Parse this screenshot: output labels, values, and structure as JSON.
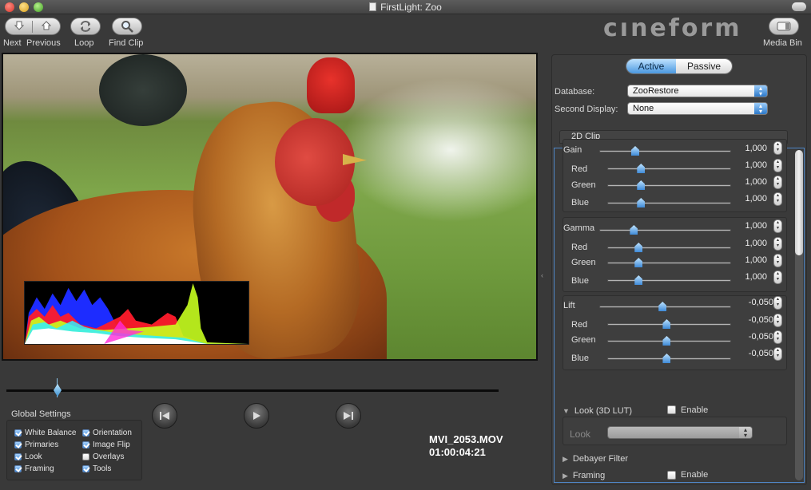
{
  "window": {
    "title": "FirstLight: Zoo"
  },
  "toolbar": {
    "next_label": "Next",
    "previous_label": "Previous",
    "loop_label": "Loop",
    "find_clip_label": "Find Clip",
    "media_bin_label": "Media Bin",
    "brand": "cıneform"
  },
  "viewer": {
    "clip_name": "MVI_2053.MOV",
    "timecode": "01:00:04:21"
  },
  "global_settings": {
    "title": "Global Settings",
    "items": [
      {
        "label": "White Balance",
        "checked": true
      },
      {
        "label": "Primaries",
        "checked": true
      },
      {
        "label": "Look",
        "checked": true
      },
      {
        "label": "Framing",
        "checked": true
      },
      {
        "label": "Orientation",
        "checked": true
      },
      {
        "label": "Image Flip",
        "checked": true
      },
      {
        "label": "Overlays",
        "checked": false
      },
      {
        "label": "Tools",
        "checked": true
      }
    ]
  },
  "panel": {
    "tabs": {
      "active": "Active",
      "passive": "Passive"
    },
    "database_label": "Database:",
    "database_value": "ZooRestore",
    "second_display_label": "Second Display:",
    "second_display_value": "None",
    "clip_tab": "2D Clip",
    "gain": {
      "label": "Gain",
      "value": "1,000",
      "red": "1,000",
      "green": "1,000",
      "blue": "1,000"
    },
    "gamma": {
      "label": "Gamma",
      "value": "1,000",
      "red": "1,000",
      "green": "1,000",
      "blue": "1,000"
    },
    "lift": {
      "label": "Lift",
      "value": "-0,050",
      "red": "-0,050",
      "green": "-0,050",
      "blue": "-0,050"
    },
    "channel_labels": {
      "red": "Red",
      "green": "Green",
      "blue": "Blue"
    },
    "look_section": "Look (3D LUT)",
    "look_enable": "Enable",
    "look_label": "Look",
    "debayer": "Debayer Filter",
    "framing": "Framing",
    "framing_enable": "Enable"
  },
  "colors": {
    "accent": "#4a98e0",
    "background": "#393939"
  }
}
